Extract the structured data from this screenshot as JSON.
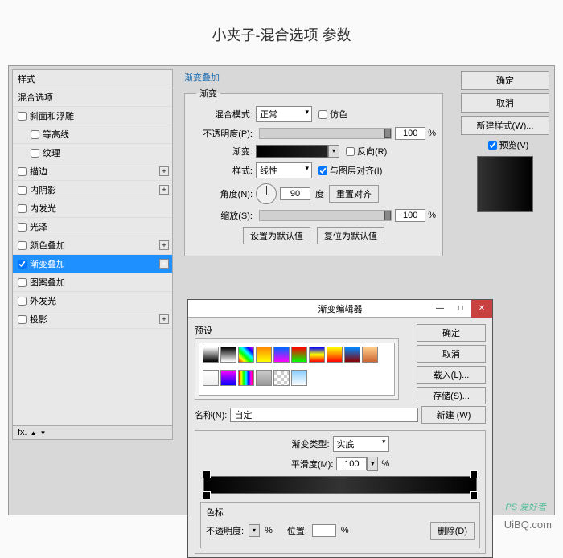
{
  "page_title": "小夹子-混合选项 参数",
  "styles_panel": {
    "header": "样式",
    "subheader": "混合选项",
    "items": [
      {
        "label": "斜面和浮雕",
        "checked": false,
        "plus": false
      },
      {
        "label": "等高线",
        "checked": false,
        "indent": true
      },
      {
        "label": "纹理",
        "checked": false,
        "indent": true
      },
      {
        "label": "描边",
        "checked": false,
        "plus": true
      },
      {
        "label": "内阴影",
        "checked": false,
        "plus": true
      },
      {
        "label": "内发光",
        "checked": false
      },
      {
        "label": "光泽",
        "checked": false
      },
      {
        "label": "颜色叠加",
        "checked": false,
        "plus": true
      },
      {
        "label": "渐变叠加",
        "checked": true,
        "plus": true,
        "selected": true
      },
      {
        "label": "图案叠加",
        "checked": false
      },
      {
        "label": "外发光",
        "checked": false
      },
      {
        "label": "投影",
        "checked": false,
        "plus": true
      }
    ],
    "fx": "fx."
  },
  "gradient_overlay": {
    "group_title": "渐变叠加",
    "legend": "渐变",
    "blend_mode_label": "混合模式:",
    "blend_mode": "正常",
    "dither_label": "仿色",
    "dither": false,
    "opacity_label": "不透明度(P):",
    "opacity": "100",
    "pct": "%",
    "gradient_label": "渐变:",
    "reverse_label": "反向(R)",
    "reverse": false,
    "style_label": "样式:",
    "style": "线性",
    "align_label": "与图层对齐(I)",
    "align": true,
    "angle_label": "角度(N):",
    "angle": "90",
    "degree": "度",
    "reset_align": "重置对齐",
    "scale_label": "缩放(S):",
    "scale": "100",
    "set_default": "设置为默认值",
    "reset_default": "复位为默认值"
  },
  "right": {
    "ok": "确定",
    "cancel": "取消",
    "new_style": "新建样式(W)...",
    "preview_label": "预览(V)",
    "preview": true
  },
  "editor": {
    "title": "渐变编辑器",
    "presets_label": "预设",
    "ok": "确定",
    "cancel": "取消",
    "load": "载入(L)...",
    "save": "存储(S)...",
    "name_label": "名称(N):",
    "name": "自定",
    "new": "新建 (W)",
    "type_label": "渐变类型:",
    "type": "实底",
    "smooth_label": "平滑度(M):",
    "smooth": "100",
    "pct": "%",
    "stops_label": "色标",
    "opacity_label": "不透明度:",
    "position_label": "位置:",
    "delete": "删除(D)"
  },
  "watermark": "PS 爱好者",
  "footer": "UiBQ.com"
}
